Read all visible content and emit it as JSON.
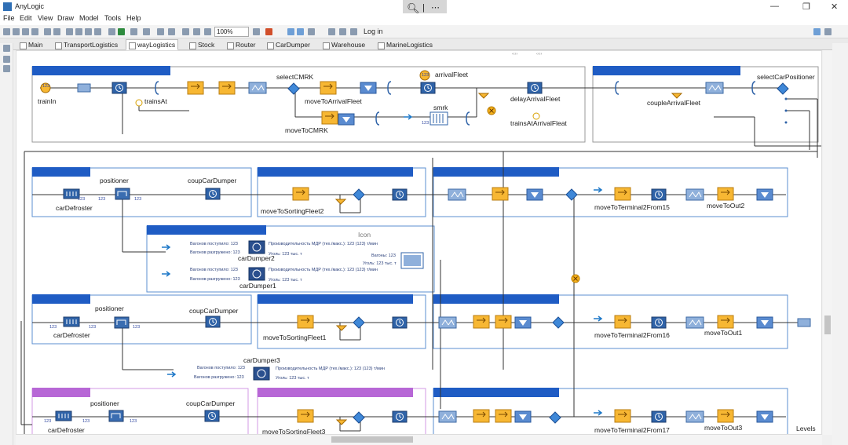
{
  "window": {
    "title": "AnyLogic"
  },
  "menu": [
    "File",
    "Edit",
    "View",
    "Draw",
    "Model",
    "Tools",
    "Help"
  ],
  "toolbar": {
    "zoom": "100%",
    "login": "Log in"
  },
  "tabs": [
    "Main",
    "TransportLogistics",
    "wayLogistics",
    "Stock",
    "Router",
    "CarDumper",
    "Warehouse",
    "MarineLogistics"
  ],
  "levels": "Levels",
  "colors": {
    "accent": "#2f6fb5",
    "header_blue": "#1f5cc4",
    "header_purple": "#b767d6",
    "block_blue": "#2f63a8",
    "queue_orange": "#f7b733",
    "selectoutput": "#3f88d8"
  },
  "diagram": {
    "labels": {
      "trainIn": "trainIn",
      "trainsAt": "trainsAt",
      "selectCMRK": "selectCMRK",
      "moveToArrivalFleet": "moveToArrivalFleet",
      "moveToCMRK": "moveToCMRK",
      "arrivalFleet": "arrivalFleet",
      "smrk": "smrk",
      "delayArrivalFleet": "delayArrivalFleet",
      "trainsAtArrivalFleat": "trainsAtArrivalFleat",
      "coupleArrivalFleet": "coupleArrivalFleet",
      "selectCarPositioner": "selectCarPositioner",
      "positioner": "positioner",
      "coupCarDumper": "coupCarDumper",
      "carDefroster": "carDefroster",
      "moveToSortingFleet2": "moveToSortingFleet2",
      "moveToTerminal2From15": "moveToTerminal2From15",
      "moveToOut2": "moveToOut2",
      "icon": "Icon",
      "carDumper2": "carDumper2",
      "carDumper1": "carDumper1",
      "moveToSortingFleet1": "moveToSortingFleet1",
      "moveToTerminal2From16": "moveToTerminal2From16",
      "moveToOut1": "moveToOut1",
      "carDumper3": "carDumper3",
      "moveToSortingFleet3": "moveToSortingFleet3",
      "moveToTerminal2From17": "moveToTerminal2From17",
      "moveToOut3": "moveToOut3"
    },
    "dumper_text": {
      "arrived": "Вагонов поступило: 123",
      "unloaded": "Вагонов разгружено: 123",
      "capacity": "Производительность МДР (тех./макс.): 123 (123) т/мин",
      "coal": "Уголь: 123 тыс. т",
      "wagons": "Вагоны: 123",
      "coal2": "Уголь: 123 тыс. т"
    },
    "counter": "123",
    "carMark": "‹‹››"
  }
}
